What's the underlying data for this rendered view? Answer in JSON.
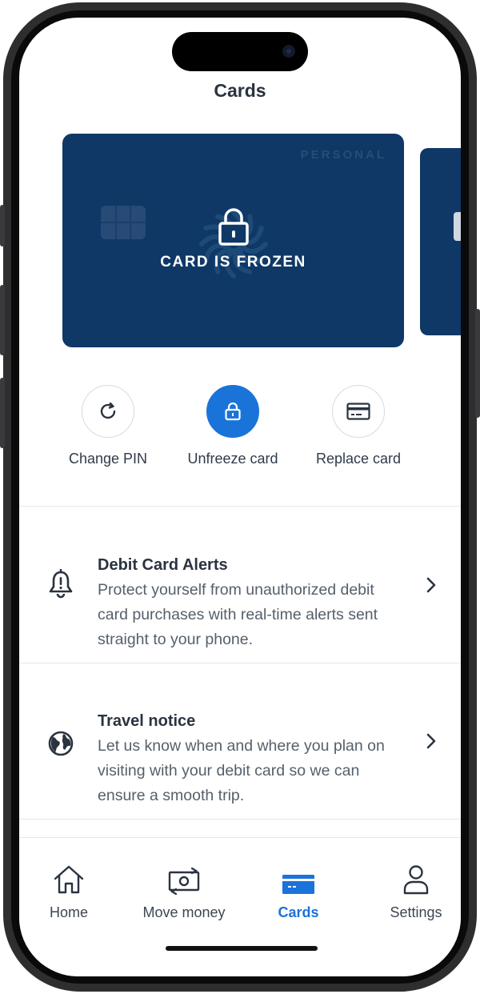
{
  "header": {
    "title": "Cards"
  },
  "card": {
    "type_label": "PERSONAL",
    "status_text": "CARD IS FROZEN",
    "color": "#0f3866"
  },
  "actions": [
    {
      "label": "Change PIN",
      "icon": "refresh-icon"
    },
    {
      "label": "Unfreeze card",
      "icon": "lock-icon",
      "primary": true
    },
    {
      "label": "Replace card",
      "icon": "credit-card-icon"
    }
  ],
  "list": [
    {
      "title": "Debit Card Alerts",
      "description": "Protect yourself from unauthorized debit card purchases with real-time alerts sent straight to your phone.",
      "icon": "bell-alert-icon"
    },
    {
      "title": "Travel notice",
      "description": "Let us know when and where you plan on visiting with your debit card so we can ensure a smooth trip.",
      "icon": "globe-icon"
    }
  ],
  "tabs": [
    {
      "label": "Home",
      "icon": "home-icon"
    },
    {
      "label": "Move money",
      "icon": "money-transfer-icon"
    },
    {
      "label": "Cards",
      "icon": "card-icon",
      "active": true
    },
    {
      "label": "Settings",
      "icon": "person-icon"
    }
  ],
  "colors": {
    "accent": "#1a73d9",
    "text_dark": "#2a3340",
    "text_muted": "#56606b"
  }
}
